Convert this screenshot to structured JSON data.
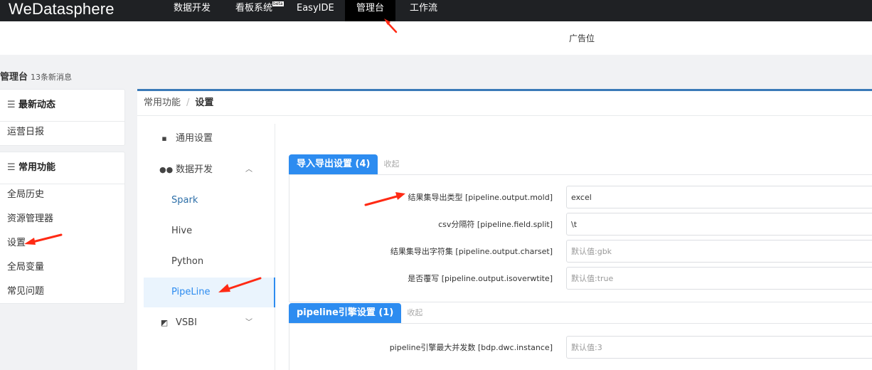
{
  "app": {
    "logo": "WeDatasphere"
  },
  "nav": [
    {
      "label": "数据开发"
    },
    {
      "label": "看板系统",
      "badge": "beta"
    },
    {
      "label": "EasyIDE"
    },
    {
      "label": "管理台",
      "active": true
    },
    {
      "label": "工作流"
    }
  ],
  "ad": {
    "text": "广告位"
  },
  "page": {
    "title": "管理台",
    "notice": "13条新消息"
  },
  "sidebar": {
    "news": {
      "title": "最新动态",
      "items": [
        "运营日报"
      ]
    },
    "common": {
      "title": "常用功能",
      "items": [
        "全局历史",
        "资源管理器",
        "设置",
        "全局变量",
        "常见问题"
      ]
    }
  },
  "breadcrumb": {
    "parent": "常用功能",
    "separator": "/",
    "current": "设置"
  },
  "menu": {
    "general": "通用设置",
    "dev": "数据开发",
    "sub": [
      "Spark",
      "Hive",
      "Python",
      "PipeLine"
    ],
    "vsbi": "VSBI",
    "active": "PipeLine"
  },
  "groups": [
    {
      "title": "导入导出设置 (4)",
      "collapse": "收起",
      "rows": [
        {
          "label": "结果集导出类型 [pipeline.output.mold]",
          "value": "excel",
          "placeholder": ""
        },
        {
          "label": "csv分隔符 [pipeline.field.split]",
          "value": "\\t",
          "placeholder": ""
        },
        {
          "label": "结果集导出字符集 [pipeline.output.charset]",
          "value": "",
          "placeholder": "默认值:gbk"
        },
        {
          "label": "是否覆写 [pipeline.output.isoverwtite]",
          "value": "",
          "placeholder": "默认值:true"
        }
      ]
    },
    {
      "title": "pipeline引擎设置 (1)",
      "collapse": "收起",
      "rows": [
        {
          "label": "pipeline引擎最大并发数 [bdp.dwc.instance]",
          "value": "",
          "placeholder": "默认值:3"
        }
      ]
    }
  ],
  "colors": {
    "accent": "#2d8cf0",
    "annotation": "#ff2a14",
    "topbar": "#1f2124"
  },
  "icons": [
    "sliders-icon",
    "book-icon",
    "users-icon",
    "chevron-up-icon",
    "chevron-down-icon",
    "chart-icon",
    "annotation-arrow"
  ]
}
